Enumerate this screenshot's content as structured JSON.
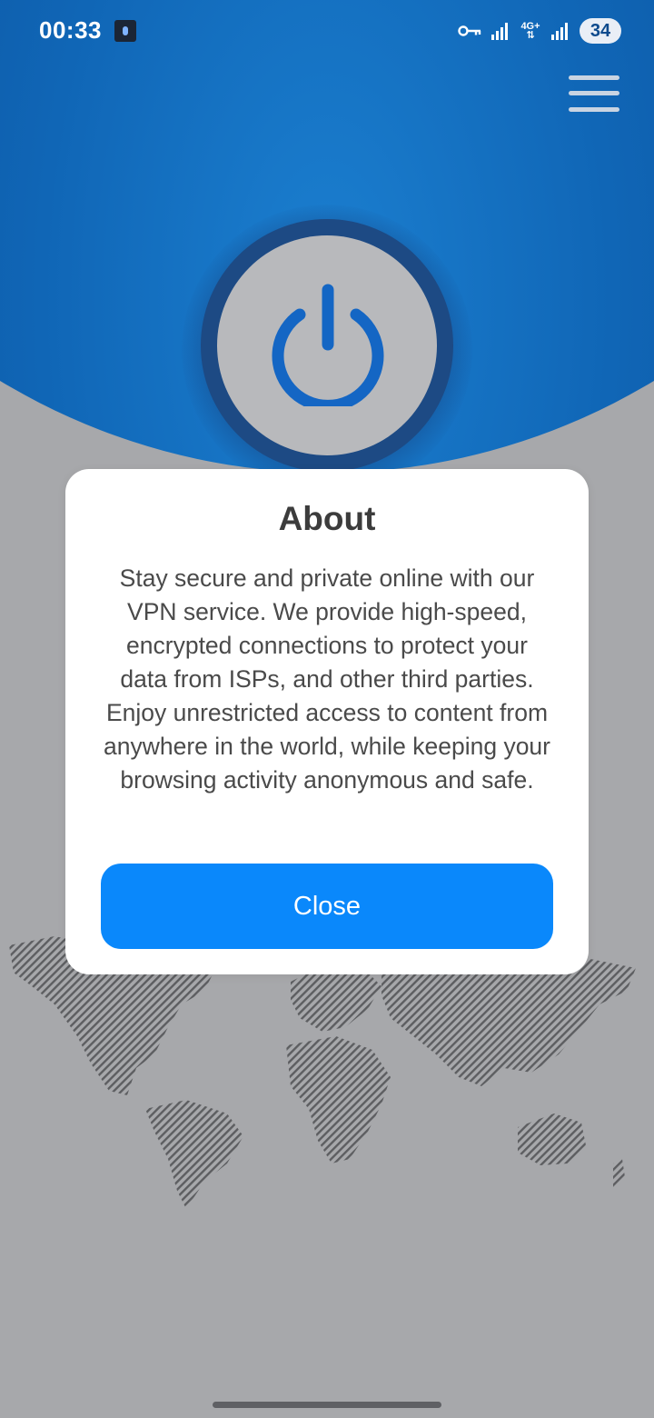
{
  "status_bar": {
    "time": "00:33",
    "network": "4G+",
    "battery": "34",
    "icons": [
      "app-notification-icon",
      "vpn-key-icon",
      "signal-icon",
      "data-arrows-icon",
      "signal-icon",
      "battery-icon"
    ]
  },
  "header": {
    "menu_icon": "hamburger-menu-icon"
  },
  "power": {
    "icon": "power-icon",
    "icon_color": "#1466c4"
  },
  "dialog": {
    "title": "About",
    "body": "Stay secure and private online with our VPN service. We provide high-speed, encrypted connections to protect your data from ISPs, and other third parties. Enjoy unrestricted access to content from anywhere in the world, while keeping your browsing activity anonymous and safe.",
    "close_label": "Close",
    "button_color": "#0a88fb"
  },
  "colors": {
    "header_blue": "#0a4f9a",
    "background_gray": "#a7a8ab"
  }
}
